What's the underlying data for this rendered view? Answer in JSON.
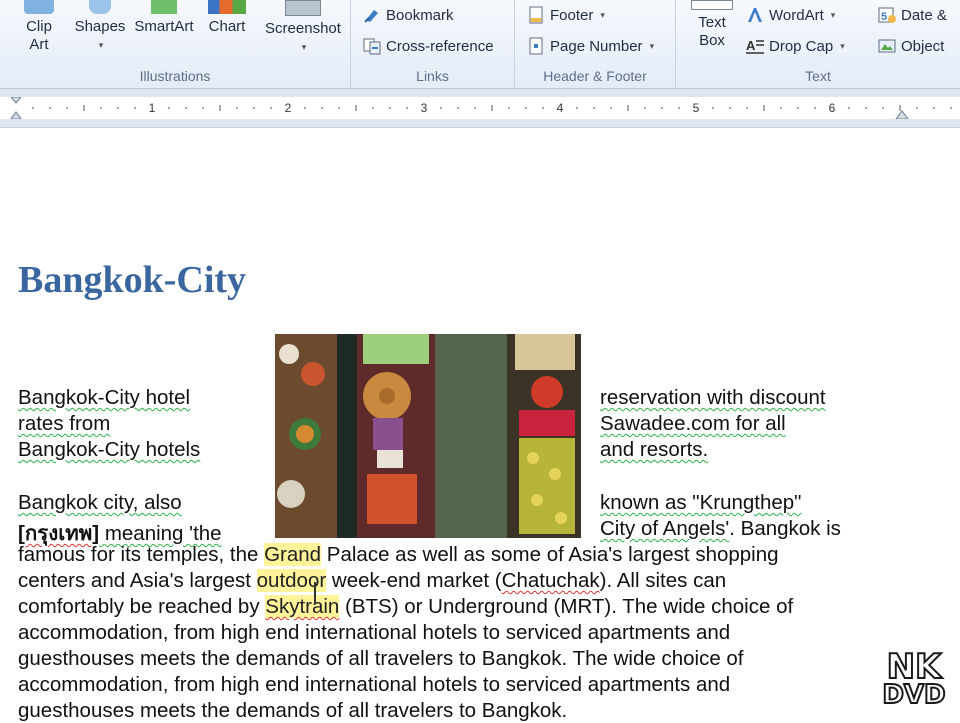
{
  "ribbon": {
    "illustrations": {
      "label": "Illustrations",
      "clip_art": "Clip Art",
      "shapes": "Shapes",
      "smartart": "SmartArt",
      "chart": "Chart",
      "screenshot": "Screenshot"
    },
    "links": {
      "label": "Links",
      "bookmark": "Bookmark",
      "cross_reference": "Cross-reference"
    },
    "header_footer": {
      "label": "Header & Footer",
      "footer": "Footer",
      "page_number": "Page Number"
    },
    "text": {
      "label": "Text",
      "text_box": "Text Box",
      "wordart": "WordArt",
      "drop_cap": "Drop Cap",
      "date_time": "Date &",
      "object": "Object"
    }
  },
  "ruler": {
    "numbers": [
      "1",
      "2",
      "3",
      "4",
      "5",
      "6"
    ]
  },
  "document": {
    "heading": "Bangkok-City",
    "left_col": [
      "Bangkok-City hotel",
      "rates from",
      "Bangkok-City hotels"
    ],
    "right_col": [
      "reservation with discount",
      "Sawadee.com for all",
      "and resorts."
    ],
    "p2_left_1": "Bangkok city, also",
    "p2_right_1": "known as \"Krungthep\"",
    "thai_word": "[กรุงเทพ]",
    "p2_left_2": " meaning 'the",
    "p2_right_2a": "City of Angels'",
    "p2_right_2b": ". Bangkok is",
    "l3a": "famous for its temples, the ",
    "l3b": "Grand",
    "l3c": " Palace as well as some of Asia's largest shopping",
    "l4a": "centers and Asia's largest ",
    "l4b": "outdoor",
    "l4c": " week-end market (",
    "l4d": "Chatuchak",
    "l4e": "). All sites can",
    "l5a": "comfortably be reached by ",
    "l5b": "Skytrain",
    "l5c": " (BTS)  or Underground (MRT). The wide choice of",
    "l6": "accommodation, from high end international hotels to serviced apartments and",
    "l7": "guesthouses meets the demands of all travelers to  Bangkok. The wide choice of",
    "l8": "accommodation, from high end international hotels to serviced apartments and",
    "l9": "guesthouses meets the demands of all travelers to  Bangkok."
  },
  "watermark": {
    "line1": "NK",
    "line2": "DVD"
  },
  "colors": {
    "heading": "#3a669f",
    "highlight": "#fff49a",
    "squiggle_green": "#2fb04a",
    "squiggle_red": "#e33333"
  }
}
